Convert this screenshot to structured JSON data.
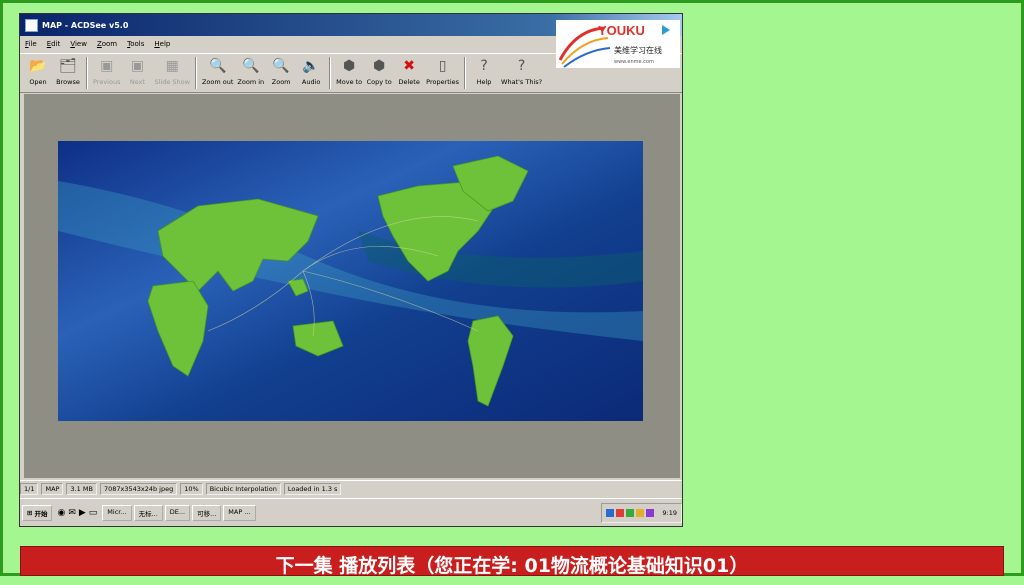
{
  "window": {
    "title": "MAP - ACDSee v5.0"
  },
  "menu": [
    "File",
    "Edit",
    "View",
    "Zoom",
    "Tools",
    "Help"
  ],
  "toolbar": [
    {
      "label": "Open",
      "icon": "folder-open-icon",
      "glyph": "📂",
      "enabled": true
    },
    {
      "label": "Browse",
      "icon": "browse-icon",
      "glyph": "🗂",
      "enabled": true
    },
    {
      "label": "Previous",
      "icon": "previous-icon",
      "glyph": "▣",
      "enabled": false
    },
    {
      "label": "Next",
      "icon": "next-icon",
      "glyph": "▣",
      "enabled": false
    },
    {
      "label": "Slide Show",
      "icon": "slideshow-icon",
      "glyph": "▦",
      "enabled": false
    },
    {
      "label": "Zoom out",
      "icon": "zoom-out-icon",
      "glyph": "🔍",
      "enabled": true
    },
    {
      "label": "Zoom in",
      "icon": "zoom-in-icon",
      "glyph": "🔍",
      "enabled": true
    },
    {
      "label": "Zoom",
      "icon": "zoom-icon",
      "glyph": "🔍",
      "enabled": true
    },
    {
      "label": "Audio",
      "icon": "audio-icon",
      "glyph": "🔈",
      "enabled": true
    },
    {
      "label": "Move to",
      "icon": "move-to-icon",
      "glyph": "⬢",
      "enabled": true
    },
    {
      "label": "Copy to",
      "icon": "copy-to-icon",
      "glyph": "⬢",
      "enabled": true
    },
    {
      "label": "Delete",
      "icon": "delete-icon",
      "glyph": "✖",
      "enabled": true
    },
    {
      "label": "Properties",
      "icon": "properties-icon",
      "glyph": "▯",
      "enabled": true
    },
    {
      "label": "Help",
      "icon": "help-icon",
      "glyph": "?",
      "enabled": true
    },
    {
      "label": "What's This?",
      "icon": "whats-this-icon",
      "glyph": "?",
      "enabled": true
    }
  ],
  "status": [
    "1/1",
    "MAP",
    "3.1 MB",
    "7087x3543x24b jpeg",
    "10%",
    "Bicubic Interpolation",
    "Loaded in 1.3 s"
  ],
  "taskbar": {
    "start": "开始",
    "tasks": [
      "Micr...",
      "无标...",
      "DE...",
      "可移...",
      "MAP ..."
    ],
    "clock": "9:19"
  },
  "watermark": {
    "brand": "YOUKU",
    "sub": "美维学习在线",
    "url": "www.enme.com"
  },
  "bottom_bar": "下一集  播放列表（您正在学: 01物流概论基础知识01）",
  "colors": {
    "page_bg": "#a3f690",
    "border": "#2e9b1f",
    "bar": "#c81e1e",
    "map_ocean": "#1a3d94",
    "map_land": "#6ec23a"
  }
}
